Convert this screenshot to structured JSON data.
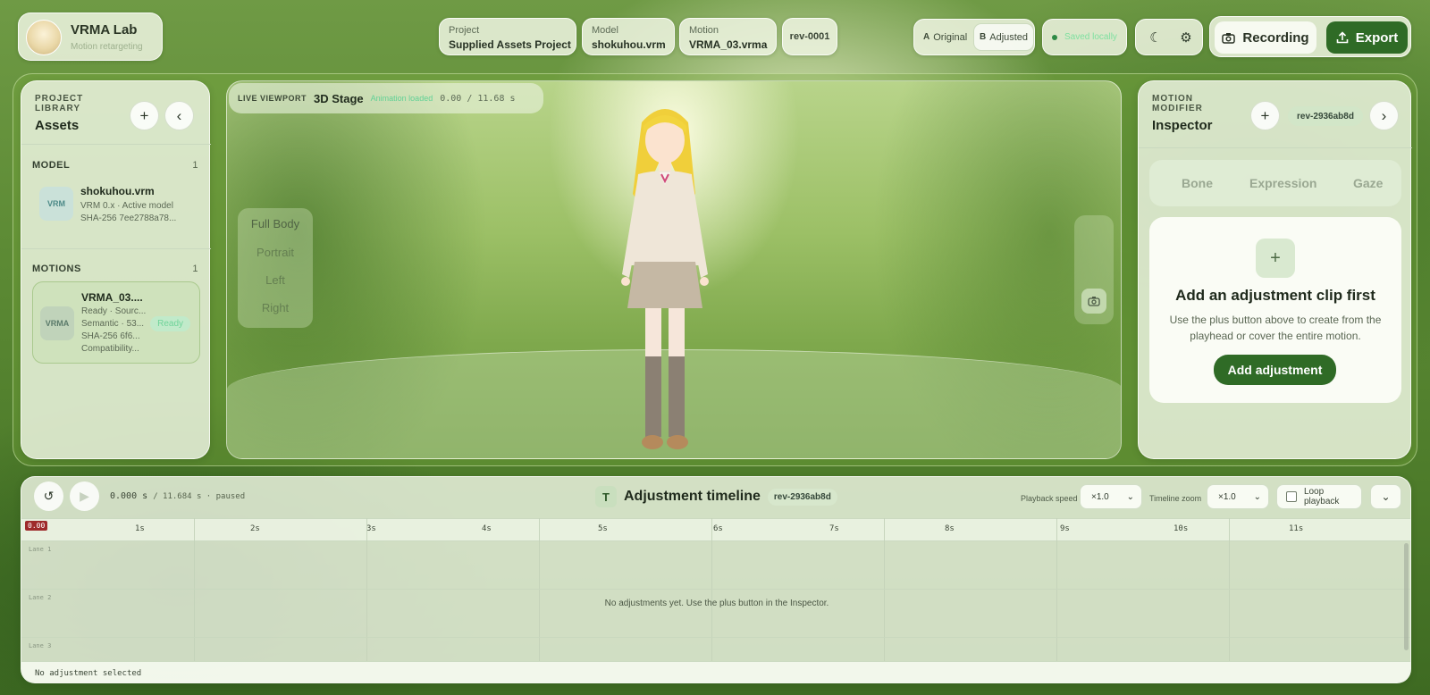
{
  "app": {
    "title": "VRMA Lab",
    "subtitle": "Motion retargeting"
  },
  "chips": {
    "project": {
      "label": "Project",
      "value": "Supplied Assets Project"
    },
    "model": {
      "label": "Model",
      "value": "shokuhou.vrm"
    },
    "motion": {
      "label": "Motion",
      "value": "VRMA_03.vrma"
    },
    "revision": "rev-0001"
  },
  "ab_toggle": {
    "original": {
      "key": "A",
      "label": "Original"
    },
    "adjusted": {
      "key": "B",
      "label": "Adjusted",
      "active": true
    }
  },
  "status": {
    "text": "Saved locally",
    "color": "#2d8a45"
  },
  "icons": {
    "theme": "moon-icon",
    "settings": "gear-icon",
    "recording": "camera-icon",
    "export": "upload-icon"
  },
  "toolbar": {
    "recording_label": "Recording",
    "export_label": "Export"
  },
  "library": {
    "eyebrow_line1": "PROJECT",
    "eyebrow_line2": "LIBRARY",
    "title": "Assets",
    "model_section": {
      "label": "MODEL",
      "count": "1"
    },
    "model": {
      "thumb": "VRM",
      "name": "shokuhou.vrm",
      "meta1": "VRM 0.x · Active model",
      "meta2": "SHA-256 7ee2788a78..."
    },
    "motions_section": {
      "label": "MOTIONS",
      "count": "1"
    },
    "motion": {
      "thumb": "VRMA",
      "name": "VRMA_03....",
      "meta1": "Ready · Sourc...",
      "meta2": "Semantic · 53...",
      "meta3": "SHA-256 6f6...",
      "meta4": "Compatibility...",
      "badge": "Ready"
    }
  },
  "viewport": {
    "eyebrow": "LIVE VIEWPORT",
    "title": "3D Stage",
    "status": "Animation loaded",
    "time": "0.00 / 11.68 s",
    "camera_options": [
      "Full Body",
      "Portrait",
      "Left",
      "Right"
    ]
  },
  "inspector": {
    "eyebrow_line1": "MOTION",
    "eyebrow_line2": "MODIFIER",
    "title": "Inspector",
    "revision": "rev-2936ab8d",
    "tabs": [
      "Bone",
      "Expression",
      "Gaze"
    ],
    "empty": {
      "title": "Add an adjustment clip first",
      "body": "Use the plus button above to create from the playhead or cover the entire motion.",
      "button": "Add adjustment"
    }
  },
  "timeline": {
    "time_current": "0.000 s",
    "time_total": "/ 11.684 s · paused",
    "title_badge": "T",
    "title": "Adjustment timeline",
    "revision": "rev-2936ab8d",
    "playback_speed_label": "Playback speed",
    "playback_speed_value": "×1.0",
    "zoom_label": "Timeline zoom",
    "zoom_value": "×1.0",
    "loop_label": "Loop playback",
    "playhead": "0.00",
    "ticks": [
      "1s",
      "2s",
      "3s",
      "4s",
      "5s",
      "6s",
      "7s",
      "8s",
      "9s",
      "10s",
      "11s"
    ],
    "lanes": [
      "Lane 1",
      "Lane 2",
      "Lane 3"
    ],
    "empty_text": "No adjustments yet. Use the plus button in the Inspector.",
    "footer": "No adjustment selected"
  }
}
